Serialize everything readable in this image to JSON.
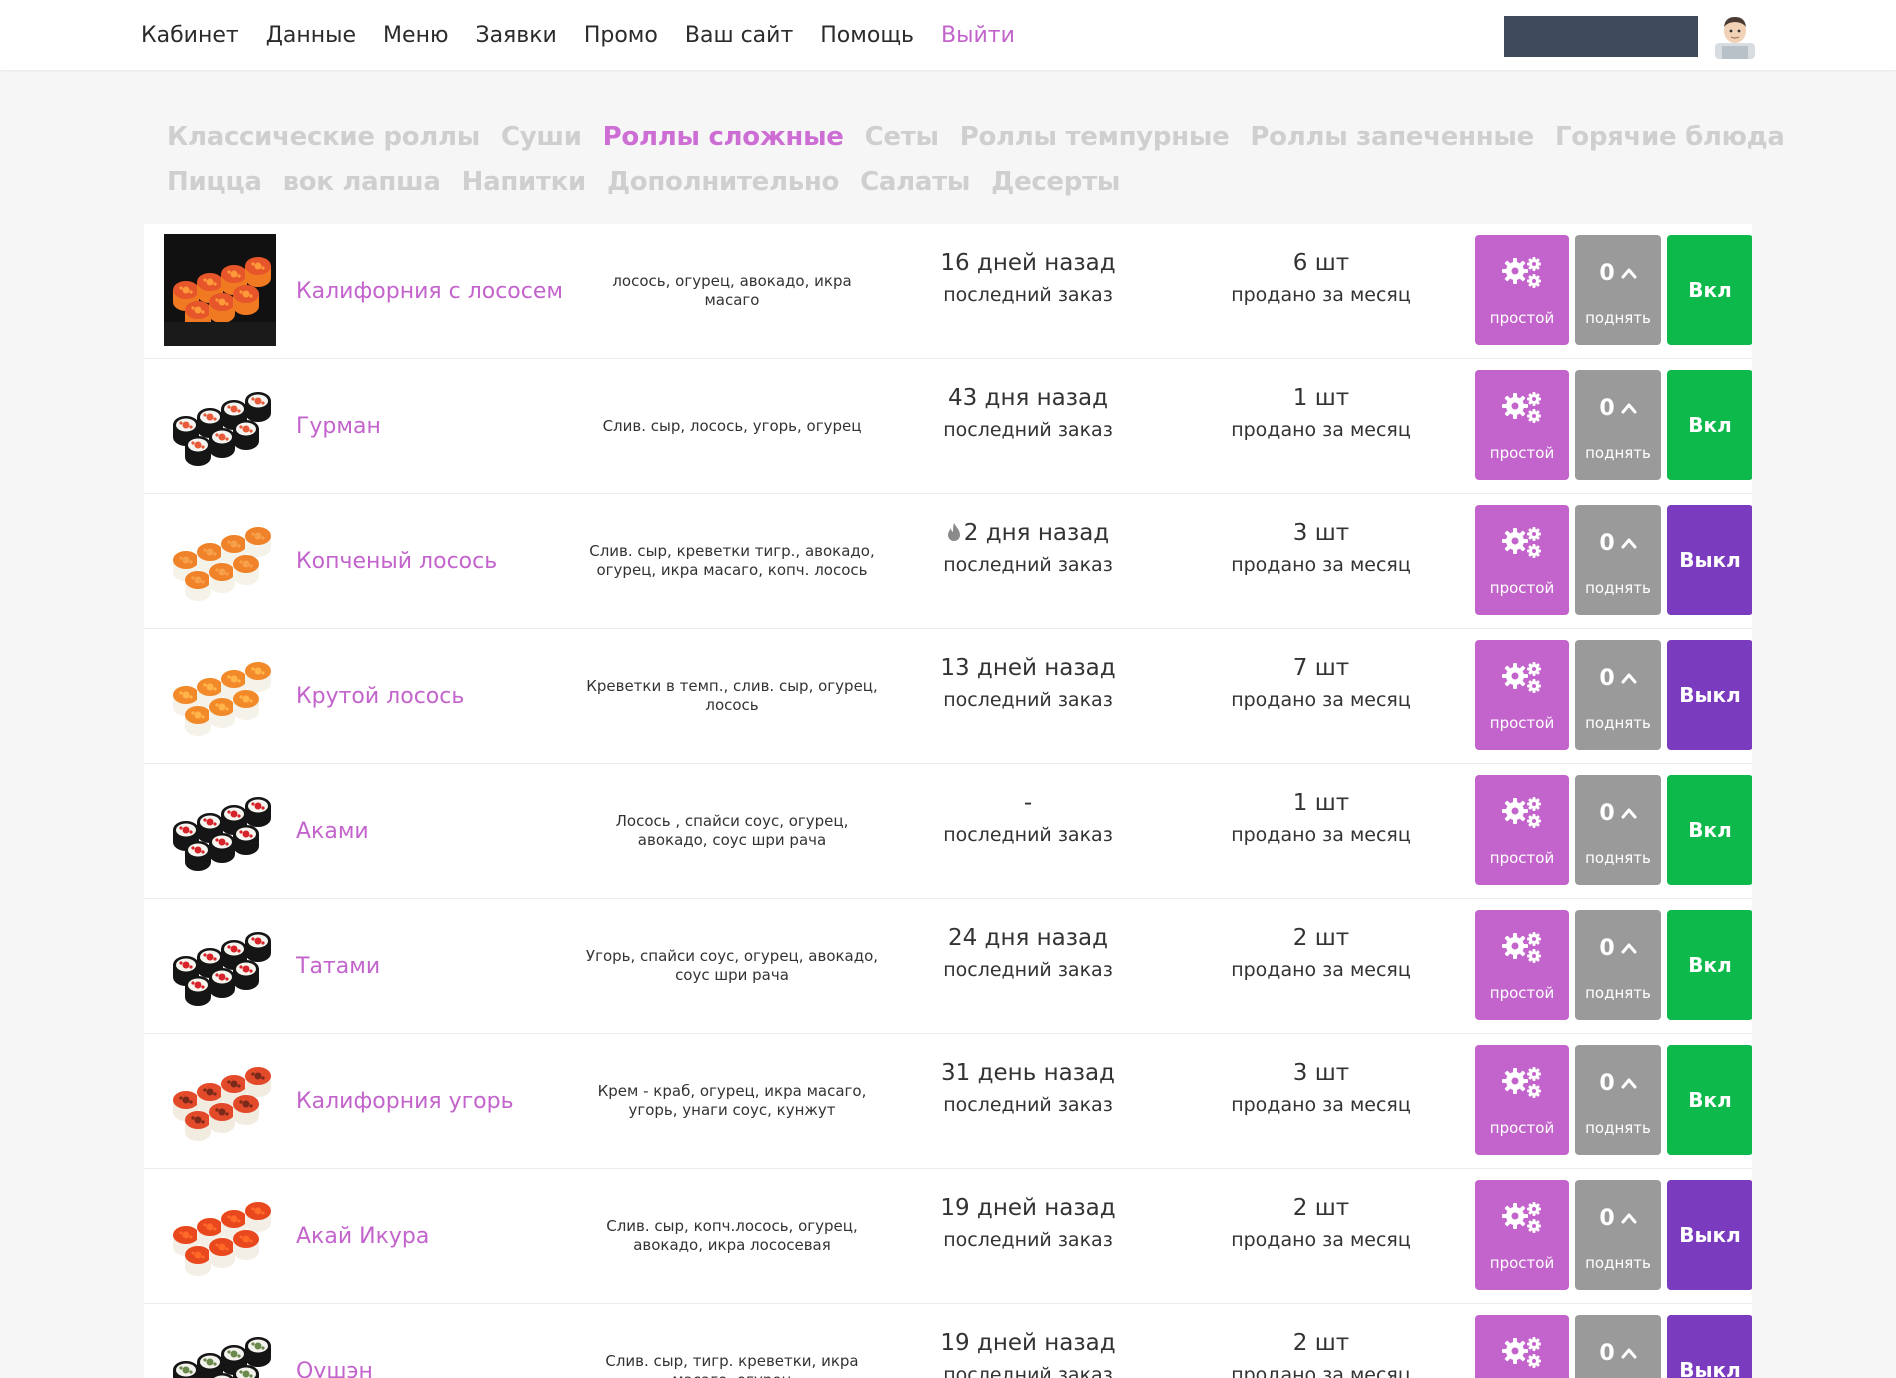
{
  "nav": {
    "items": [
      "Кабинет",
      "Данные",
      "Меню",
      "Заявки",
      "Промо",
      "Ваш сайт",
      "Помощь"
    ],
    "logout": "Выйти"
  },
  "categories": {
    "row1": [
      "Классические роллы",
      "Суши",
      "Роллы сложные",
      "Сеты",
      "Роллы темпурные",
      "Роллы запеченные",
      "Горячие блюда"
    ],
    "row2": [
      "Пицца",
      "вок лапша",
      "Напитки",
      "Дополнительно",
      "Салаты",
      "Десерты"
    ],
    "active": "Роллы сложные"
  },
  "labels": {
    "last_order": "последний заказ",
    "sold_month": "продано за месяц",
    "type_btn": "простой",
    "up_btn": "поднять"
  },
  "colors": {
    "accent": "#c364cc",
    "on": "#0cb94a",
    "off": "#7a3bbf",
    "up": "#9a9a9a"
  },
  "products": [
    {
      "name": "Калифорния с лососем",
      "desc": "лосось, огурец, авокадо, икра масаго",
      "last_order": "16 дней назад",
      "hot": false,
      "sold": "6 шт",
      "up_count": "0",
      "toggle": "Вкл",
      "thumb": "california-salmon-roll"
    },
    {
      "name": "Гурман",
      "desc": "Слив. сыр, лосось, угорь, огурец",
      "last_order": "43 дня назад",
      "hot": false,
      "sold": "1 шт",
      "up_count": "0",
      "toggle": "Вкл",
      "thumb": "nori-rolls"
    },
    {
      "name": "Копченый лосось",
      "desc": "Слив. сыр, креветки тигр., авокадо, огурец, икра масаго, копч. лосось",
      "last_order": "2 дня назад",
      "hot": true,
      "sold": "3 шт",
      "up_count": "0",
      "toggle": "Выкл",
      "thumb": "smoked-salmon-roll"
    },
    {
      "name": "Крутой лосось",
      "desc": "Креветки в темп., слив. сыр, огурец, лосось",
      "last_order": "13 дней назад",
      "hot": false,
      "sold": "7 шт",
      "up_count": "0",
      "toggle": "Выкл",
      "thumb": "salmon-roll"
    },
    {
      "name": "Аками",
      "desc": "Лосось , спайси соус, огурец, авокадо, соус шри рача",
      "last_order": "-",
      "hot": false,
      "sold": "1 шт",
      "up_count": "0",
      "toggle": "Вкл",
      "thumb": "akami-roll"
    },
    {
      "name": "Татами",
      "desc": "Угорь, спайси соус, огурец, авокадо, соус шри рача",
      "last_order": "24 дня назад",
      "hot": false,
      "sold": "2 шт",
      "up_count": "0",
      "toggle": "Вкл",
      "thumb": "tatami-roll"
    },
    {
      "name": "Калифорния угорь",
      "desc": "Крем - краб, огурец, икра масаго, угорь, унаги соус, кунжут",
      "last_order": "31 день назад",
      "hot": false,
      "sold": "3 шт",
      "up_count": "0",
      "toggle": "Вкл",
      "thumb": "eel-roll"
    },
    {
      "name": "Акай Икура",
      "desc": "Слив. сыр, копч.лосось, огурец, авокадо, икра лососевая",
      "last_order": "19 дней назад",
      "hot": false,
      "sold": "2 шт",
      "up_count": "0",
      "toggle": "Выкл",
      "thumb": "ikura-roll"
    },
    {
      "name": "Оушэн",
      "desc": "Слив. сыр, тигр. креветки, икра масаго, огурец",
      "last_order": "19 дней назад",
      "hot": false,
      "sold": "2 шт",
      "up_count": "0",
      "toggle": "Выкл",
      "thumb": "ocean-roll"
    }
  ]
}
